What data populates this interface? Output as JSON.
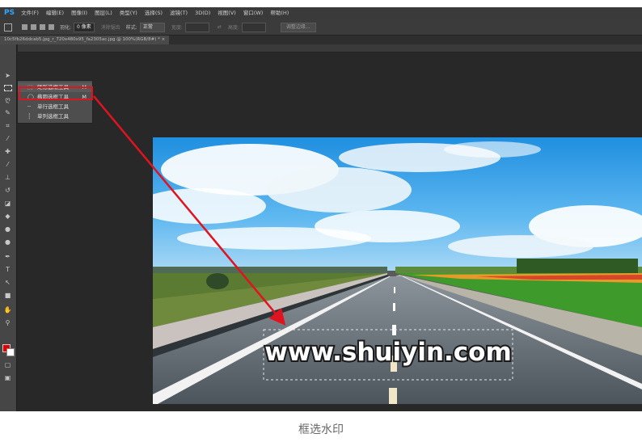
{
  "app": {
    "logo": "PS",
    "menus": [
      "文件(F)",
      "编辑(E)",
      "图像(I)",
      "图层(L)",
      "类型(Y)",
      "选择(S)",
      "滤镜(T)",
      "3D(D)",
      "视图(V)",
      "窗口(W)",
      "帮助(H)"
    ]
  },
  "options": {
    "feather_label": "羽化:",
    "feather_value": "0 像素",
    "antialias_label": "消除锯齿",
    "style_label": "样式:",
    "style_value": "正常",
    "width_label": "宽度:",
    "height_label": "高度:",
    "refine_button": "调整边缘..."
  },
  "document": {
    "tab_title": "10c5fb26ddcab5.jpg_r_720x480x95_fa2305ac.jpg @ 100%(RGB/8#) *",
    "close": "×"
  },
  "flyout": {
    "items": [
      {
        "icon": "rectangle-select-icon",
        "label": "矩形选框工具",
        "shortcut": "M"
      },
      {
        "icon": "ellipse-select-icon",
        "label": "椭圆选框工具",
        "shortcut": "M"
      },
      {
        "icon": "single-row-select-icon",
        "label": "单行选框工具",
        "shortcut": ""
      },
      {
        "icon": "single-column-select-icon",
        "label": "单列选框工具",
        "shortcut": ""
      }
    ]
  },
  "image": {
    "watermark": "www.shuiyin.com"
  },
  "colors": {
    "foreground": "#e00000",
    "background": "#ffffff",
    "annotation": "#e01420"
  },
  "caption": "框选水印"
}
